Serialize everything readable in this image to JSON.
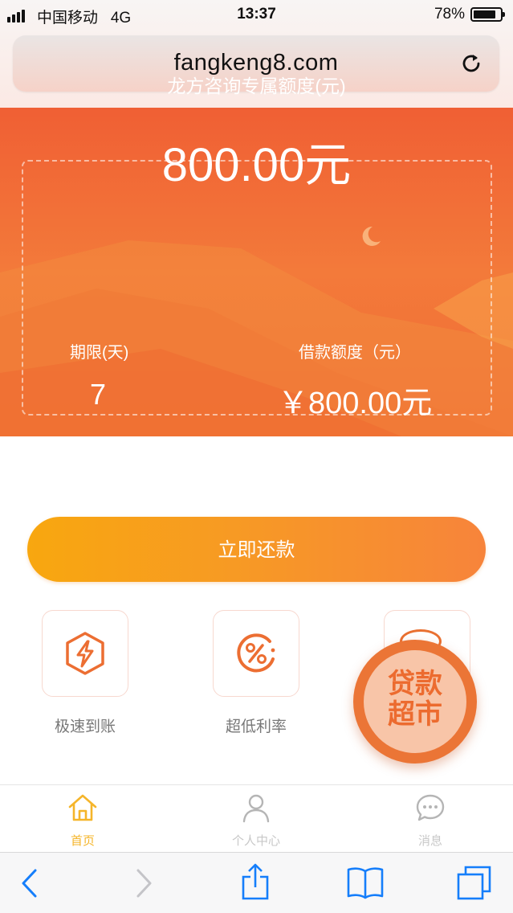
{
  "status_bar": {
    "carrier": "中国移动",
    "network": "4G",
    "time": "13:37",
    "battery": "78%",
    "battery_level": 0.78
  },
  "browser": {
    "url": "fangkeng8.com"
  },
  "hero": {
    "title": "龙方咨询专属额度(元)",
    "amount": "800.00元",
    "term_label": "期限(天)",
    "term_value": "7",
    "limit_label": "借款额度（元）",
    "limit_value": "￥800.00元"
  },
  "repay_button": "立即还款",
  "features": [
    {
      "label": "极速到账",
      "icon": "lightning-icon"
    },
    {
      "label": "超低利率",
      "icon": "percent-icon"
    },
    {
      "label": "",
      "icon": "bag-icon"
    }
  ],
  "float_market": {
    "line1": "贷款",
    "line2": "超市"
  },
  "tabs": [
    {
      "label": "首页",
      "icon": "home-icon",
      "active": true
    },
    {
      "label": "个人中心",
      "icon": "user-icon",
      "active": false
    },
    {
      "label": "消息",
      "icon": "chat-icon",
      "active": false
    }
  ],
  "colors": {
    "accent": "#f26a33",
    "tab_active": "#f5b52a",
    "tab_inactive": "#b5b5b5",
    "ios_blue": "#157efb"
  }
}
